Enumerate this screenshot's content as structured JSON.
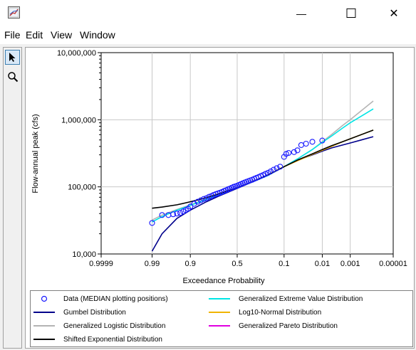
{
  "window": {
    "controls": {
      "minimize": "—",
      "maximize": "☐",
      "close": "✕"
    }
  },
  "menu": [
    "File",
    "Edit",
    "View",
    "Window"
  ],
  "toolbar": {
    "tools": [
      "pointer-icon",
      "zoom-icon"
    ]
  },
  "colors": {
    "gumbel": "#00008b",
    "logistic": "#b4b4b4",
    "shifted_exp": "#000000",
    "gev": "#00e5e5",
    "lognormal": "#f0b400",
    "pareto": "#e000e0",
    "data": "#1a1aff"
  },
  "chart_data": {
    "type": "scatter",
    "xlabel": "Exceedance Probability",
    "ylabel": "Flow-annual peak (cfs)",
    "x_scale": "normal-probability",
    "y_scale": "log",
    "x_ticks": [
      "0.9999",
      "0.99",
      "0.9",
      "0.5",
      "0.1",
      "0.01",
      "0.001",
      "0.00001"
    ],
    "y_ticks": [
      "10,000",
      "100,000",
      "1,000,000",
      "10,000,000"
    ],
    "xlim": [
      0.9999,
      1e-05
    ],
    "ylim": [
      10000,
      10000000
    ],
    "grid": true,
    "legend_position": "bottom",
    "series": [
      {
        "name": "Data (MEDIAN plotting positions)",
        "kind": "points",
        "x": [
          0.99,
          0.98,
          0.97,
          0.96,
          0.95,
          0.94,
          0.93,
          0.92,
          0.91,
          0.9,
          0.88,
          0.86,
          0.84,
          0.82,
          0.8,
          0.78,
          0.76,
          0.74,
          0.72,
          0.7,
          0.68,
          0.66,
          0.64,
          0.62,
          0.6,
          0.58,
          0.56,
          0.54,
          0.52,
          0.5,
          0.48,
          0.46,
          0.44,
          0.42,
          0.4,
          0.38,
          0.36,
          0.34,
          0.32,
          0.3,
          0.28,
          0.26,
          0.24,
          0.22,
          0.2,
          0.18,
          0.16,
          0.14,
          0.12,
          0.1,
          0.09,
          0.08,
          0.06,
          0.05,
          0.04,
          0.03,
          0.02,
          0.01
        ],
        "y": [
          29000,
          38000,
          38000,
          39000,
          40000,
          41000,
          43000,
          45000,
          47000,
          51000,
          56000,
          60000,
          63000,
          66000,
          68000,
          71000,
          73000,
          76000,
          78000,
          80000,
          82000,
          84000,
          87000,
          89000,
          92000,
          94000,
          97000,
          100000,
          102000,
          104000,
          107000,
          110000,
          113000,
          116000,
          119000,
          122000,
          125000,
          128000,
          132000,
          136000,
          140000,
          145000,
          150000,
          156000,
          162000,
          170000,
          180000,
          190000,
          200000,
          280000,
          310000,
          320000,
          330000,
          350000,
          420000,
          440000,
          470000,
          490000
        ]
      },
      {
        "name": "Gumbel Distribution",
        "kind": "line",
        "x": [
          0.99,
          0.98,
          0.95,
          0.9,
          0.8,
          0.7,
          0.5,
          0.3,
          0.2,
          0.1,
          0.05,
          0.02,
          0.01,
          0.005,
          0.002,
          0.001,
          0.0001
        ],
        "y": [
          11000,
          20000,
          34000,
          45000,
          60000,
          72000,
          95000,
          125000,
          150000,
          200000,
          250000,
          300000,
          340000,
          380000,
          420000,
          450000,
          560000
        ]
      },
      {
        "name": "Generalized Logistic Distribution",
        "kind": "line",
        "x": [
          0.99,
          0.98,
          0.95,
          0.9,
          0.8,
          0.7,
          0.5,
          0.3,
          0.2,
          0.1,
          0.05,
          0.02,
          0.01,
          0.005,
          0.002,
          0.001,
          0.0001
        ],
        "y": [
          32000,
          38000,
          46000,
          54000,
          66000,
          76000,
          97000,
          125000,
          148000,
          200000,
          260000,
          360000,
          470000,
          600000,
          820000,
          1000000,
          1900000
        ]
      },
      {
        "name": "Shifted Exponential Distribution",
        "kind": "line",
        "x": [
          0.99,
          0.98,
          0.95,
          0.9,
          0.8,
          0.7,
          0.5,
          0.3,
          0.2,
          0.1,
          0.05,
          0.02,
          0.01,
          0.005,
          0.002,
          0.001,
          0.0001
        ],
        "y": [
          48000,
          50000,
          54000,
          60000,
          69000,
          78000,
          97000,
          127000,
          150000,
          200000,
          250000,
          310000,
          360000,
          410000,
          470000,
          520000,
          700000
        ]
      },
      {
        "name": "Generalized Extreme Value Distribution",
        "kind": "line",
        "x": [
          0.99,
          0.98,
          0.95,
          0.9,
          0.8,
          0.7,
          0.5,
          0.3,
          0.2,
          0.1,
          0.05,
          0.02,
          0.01,
          0.005,
          0.002,
          0.001,
          0.0001
        ],
        "y": [
          30000,
          36000,
          45000,
          53000,
          65000,
          76000,
          97000,
          125000,
          148000,
          200000,
          260000,
          360000,
          460000,
          570000,
          750000,
          900000,
          1450000
        ]
      },
      {
        "name": "Log10-Normal Distribution",
        "kind": "line",
        "x": [
          0.2,
          0.1,
          0.05,
          0.02,
          0.01,
          0.005,
          0.002,
          0.001,
          0.0001
        ],
        "y": [
          150000,
          200000,
          245000,
          305000,
          350000,
          400000,
          470000,
          520000,
          700000
        ]
      },
      {
        "name": "Generalized Pareto Distribution",
        "kind": "line",
        "x": [],
        "y": []
      }
    ]
  }
}
